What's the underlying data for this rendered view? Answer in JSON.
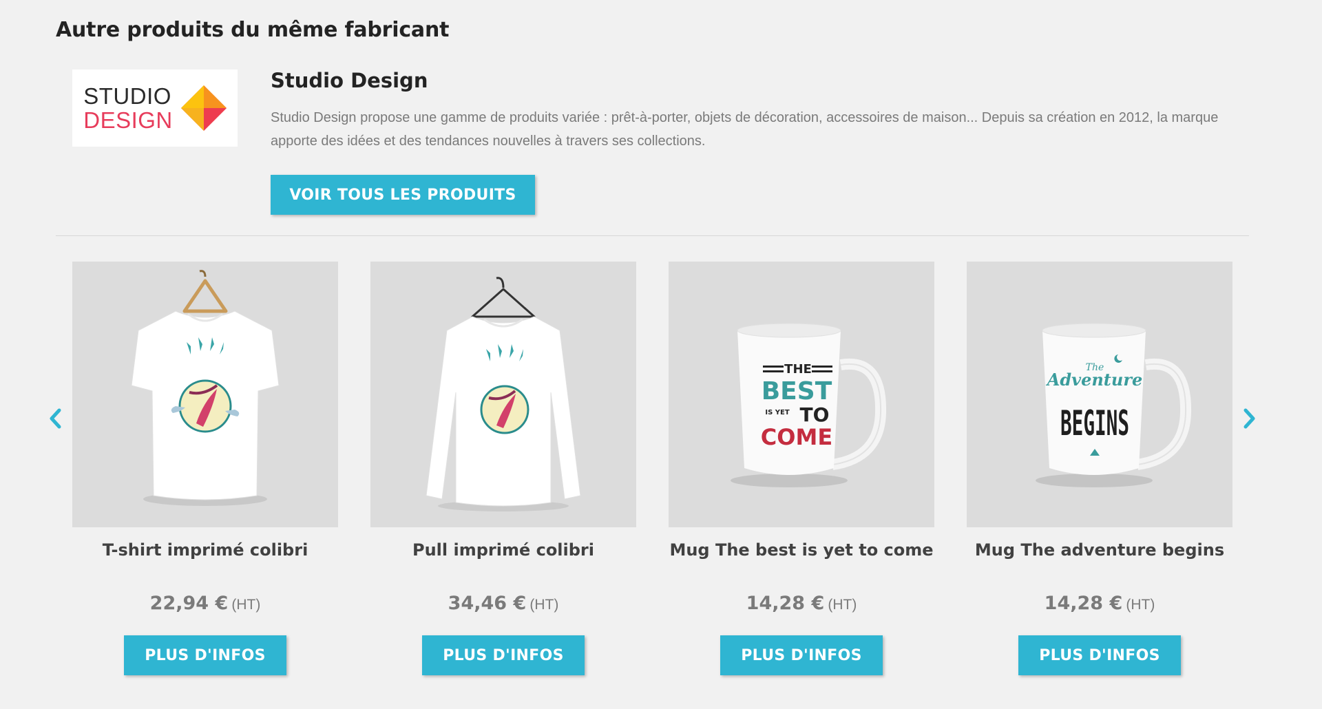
{
  "section": {
    "title": "Autre produits du même fabricant"
  },
  "brand": {
    "logo_line1": "STUDIO",
    "logo_line2": "DESIGN",
    "name": "Studio Design",
    "description": "Studio Design propose une gamme de produits variée : prêt-à-porter, objets de décoration, accessoires de maison... Depuis sa création en 2012, la marque apporte des idées et des tendances nouvelles à travers ses collections.",
    "all_products_label": "VOIR TOUS LES PRODUITS"
  },
  "carousel": {
    "prev_icon": "chevron-left-icon",
    "next_icon": "chevron-right-icon"
  },
  "products": [
    {
      "name": "T-shirt imprimé colibri",
      "price": "22,94 €",
      "tax": "(HT)",
      "button": "PLUS D'INFOS",
      "image": "tshirt-hummingbird-image"
    },
    {
      "name": "Pull imprimé colibri",
      "price": "34,46 €",
      "tax": "(HT)",
      "button": "PLUS D'INFOS",
      "image": "sweater-hummingbird-image"
    },
    {
      "name": "Mug The best is yet to come",
      "price": "14,28 €",
      "tax": "(HT)",
      "button": "PLUS D'INFOS",
      "image": "mug-best-yet-to-come-image",
      "mug_text": [
        "THE",
        "BEST",
        "IS YET",
        "TO",
        "COME"
      ]
    },
    {
      "name": "Mug The adventure begins",
      "price": "14,28 €",
      "tax": "(HT)",
      "button": "PLUS D'INFOS",
      "image": "mug-adventure-begins-image",
      "mug_text": [
        "The",
        "Adventure",
        "BEGINS"
      ]
    }
  ],
  "colors": {
    "accent": "#2fb5d2",
    "background": "#f1f1f1",
    "logo_red": "#e73c5b"
  }
}
